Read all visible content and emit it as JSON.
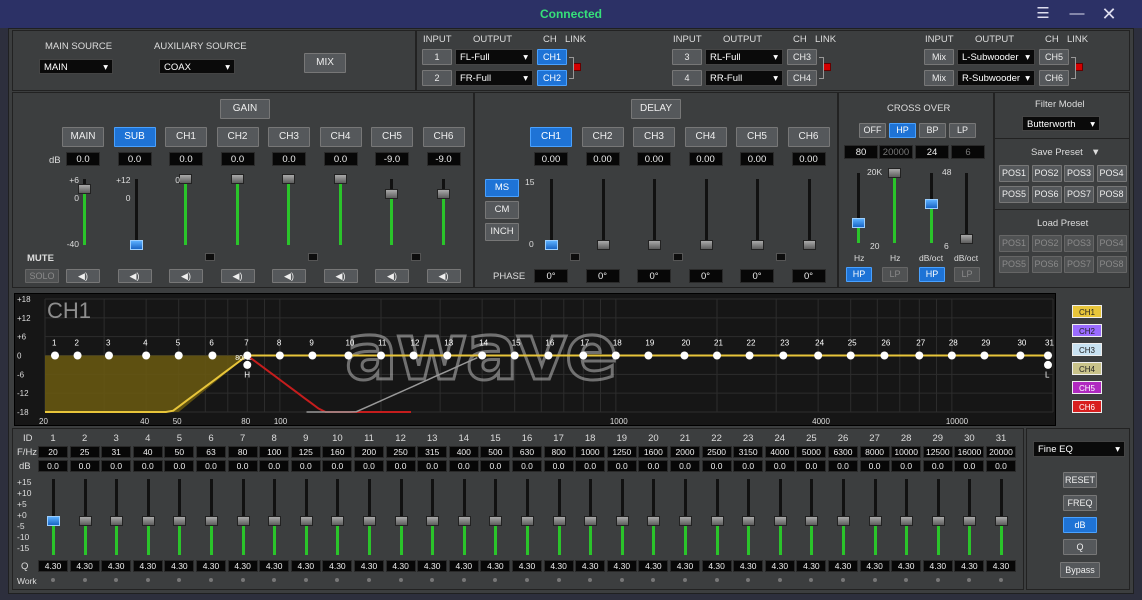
{
  "window": {
    "status": "Connected",
    "menu_icon": "menu-icon",
    "min_icon": "minimize-icon",
    "close_icon": "close-icon"
  },
  "source": {
    "main_label": "MAIN SOURCE",
    "main_value": "MAIN",
    "aux_label": "AUXILIARY SOURCE",
    "aux_value": "COAX",
    "mix_button": "MIX"
  },
  "routing": {
    "headers": {
      "input": "INPUT",
      "output": "OUTPUT",
      "ch": "CH",
      "link": "LINK"
    },
    "rows": [
      {
        "input": "1",
        "output": "FL-Full",
        "ch": "CH1"
      },
      {
        "input": "2",
        "output": "FR-Full",
        "ch": "CH2"
      },
      {
        "input": "3",
        "output": "RL-Full",
        "ch": "CH3"
      },
      {
        "input": "4",
        "output": "RR-Full",
        "ch": "CH4"
      },
      {
        "input": "Mix",
        "output": "L-Subwooder",
        "ch": "CH5"
      },
      {
        "input": "Mix",
        "output": "R-Subwooder",
        "ch": "CH6"
      }
    ]
  },
  "gain": {
    "title": "GAIN",
    "db_label": "dB",
    "mute_label": "MUTE",
    "solo_label": "SOLO",
    "channels": [
      {
        "name": "MAIN",
        "db": "0.0",
        "level": 0.85,
        "scale_top": "+6",
        "scale_mid": "0",
        "scale_bot": "-40"
      },
      {
        "name": "SUB",
        "db": "0.0",
        "level": 0.0,
        "scale_top": "+12",
        "scale_mid": "0",
        "scale_bot": ""
      },
      {
        "name": "CH1",
        "db": "0.0",
        "level": 1.0,
        "scale_top": "0",
        "scale_mid": "",
        "scale_bot": ""
      },
      {
        "name": "CH2",
        "db": "0.0",
        "level": 1.0,
        "scale_top": "",
        "scale_mid": "",
        "scale_bot": ""
      },
      {
        "name": "CH3",
        "db": "0.0",
        "level": 1.0,
        "scale_top": "",
        "scale_mid": "",
        "scale_bot": ""
      },
      {
        "name": "CH4",
        "db": "0.0",
        "level": 1.0,
        "scale_top": "",
        "scale_mid": "",
        "scale_bot": ""
      },
      {
        "name": "CH5",
        "db": "-9.0",
        "level": 0.78,
        "scale_top": "",
        "scale_mid": "",
        "scale_bot": ""
      },
      {
        "name": "CH6",
        "db": "-9.0",
        "level": 0.78,
        "scale_top": "",
        "scale_mid": "",
        "scale_bot": ""
      }
    ]
  },
  "delay": {
    "title": "DELAY",
    "phase_label": "PHASE",
    "units": [
      "MS",
      "CM",
      "INCH"
    ],
    "scale_top": "15",
    "scale_bot": "0",
    "channels": [
      {
        "name": "CH1",
        "value": "0.00",
        "phase": "0°"
      },
      {
        "name": "CH2",
        "value": "0.00",
        "phase": "0°"
      },
      {
        "name": "CH3",
        "value": "0.00",
        "phase": "0°"
      },
      {
        "name": "CH4",
        "value": "0.00",
        "phase": "0°"
      },
      {
        "name": "CH5",
        "value": "0.00",
        "phase": "0°"
      },
      {
        "name": "CH6",
        "value": "0.00",
        "phase": "0°"
      }
    ]
  },
  "crossover": {
    "title": "CROSS OVER",
    "modes": [
      "OFF",
      "HP",
      "BP",
      "LP"
    ],
    "hp_freq": "80",
    "lp_freq": "20000",
    "hp_slope": "24",
    "lp_slope": "6",
    "scale_20k": "20K",
    "scale_20": "20",
    "scale_48": "48",
    "scale_6": "6",
    "hz1": "Hz",
    "hz2": "Hz",
    "oct1": "dB/oct",
    "oct2": "dB/oct",
    "hp": "HP",
    "lp": "LP"
  },
  "filter": {
    "label": "Filter Model",
    "value": "Butterworth",
    "save_label": "Save Preset",
    "load_label": "Load Preset",
    "presets": [
      "POS1",
      "POS2",
      "POS3",
      "POS4",
      "POS5",
      "POS6",
      "POS7",
      "POS8"
    ]
  },
  "graph": {
    "channel": "CH1",
    "logo": "awave",
    "marker_label": "80Hz",
    "marker_h": "H",
    "marker_l": "L",
    "y_ticks": [
      "+18",
      "+12",
      "+6",
      "0",
      "-6",
      "-12",
      "-18"
    ],
    "x_ticks": [
      "20",
      "40",
      "50",
      "80",
      "100",
      "1000",
      "4000",
      "10000"
    ],
    "legend": [
      {
        "name": "CH1",
        "color": "#e8c53a"
      },
      {
        "name": "CH2",
        "color": "#9a6bff"
      },
      {
        "name": "CH3",
        "color": "#c8e2f2"
      },
      {
        "name": "CH4",
        "color": "#c9c38a"
      },
      {
        "name": "CH5",
        "color": "#b029c0"
      },
      {
        "name": "CH6",
        "color": "#d81f1f"
      }
    ]
  },
  "bands": {
    "id_label": "ID",
    "freq_label": "F/Hz",
    "db_label": "dB",
    "q_label": "Q",
    "work_label": "Work",
    "scale": [
      "+15",
      "+10",
      "+5",
      "+0",
      "-5",
      "-10",
      "-15"
    ],
    "freqs": [
      "20",
      "25",
      "31",
      "40",
      "50",
      "63",
      "80",
      "100",
      "125",
      "160",
      "200",
      "250",
      "315",
      "400",
      "500",
      "630",
      "800",
      "1000",
      "1250",
      "1600",
      "2000",
      "2500",
      "3150",
      "4000",
      "5000",
      "6300",
      "8000",
      "10000",
      "12500",
      "16000",
      "20000"
    ],
    "db": "0.0",
    "q": "4.30"
  },
  "side": {
    "mode": "Fine EQ",
    "reset": "RESET",
    "freq": "FREQ",
    "db": "dB",
    "q": "Q",
    "bypass": "Bypass"
  }
}
